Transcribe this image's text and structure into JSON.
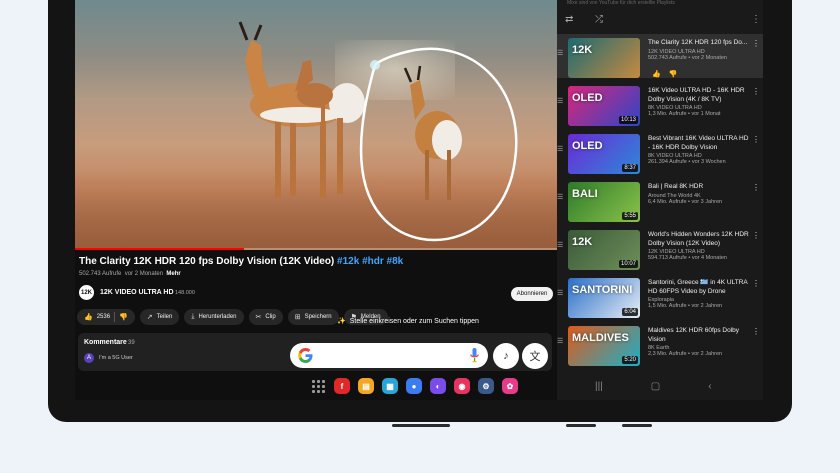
{
  "player": {
    "progress": 0.35
  },
  "video": {
    "title": "The Clarity 12K HDR 120 fps Dolby Vision (12K Video) ",
    "tags": "#12k #hdr #8k",
    "views": "502.743 Aufrufe",
    "age": "vor 2 Monaten",
    "more": "Mehr"
  },
  "channel": {
    "logo_text": "12K",
    "name": "12K VIDEO ULTRA HD",
    "subs": "148.000",
    "subscribe_label": "Abonnieren"
  },
  "actions": {
    "likes": "2536",
    "share": "Teilen",
    "download": "Herunterladen",
    "clip": "Clip",
    "save": "Speichern",
    "report": "Melden"
  },
  "circle_search": {
    "hint": "Stelle einkreisen oder zum Suchen tippen"
  },
  "comments": {
    "label": "Kommentare",
    "count": "39",
    "avatar": "A",
    "preview": "I'm a 5G User"
  },
  "playlist": {
    "hint": "Mixe sind von YouTube für dich erstellte Playlists",
    "items": [
      {
        "title": "The Clarity 12K HDR 120 fps Do...",
        "channel": "12K VIDEO ULTRA HD",
        "meta": "502.743 Aufrufe • vor 2 Monaten",
        "duration": "",
        "label": "12K",
        "c1": "#1d6b73",
        "c2": "#c78a3f"
      },
      {
        "title": "16K Video ULTRA HD - 16K HDR Dolby Vision (4K / 8K TV)",
        "channel": "8K VIDEO ULTRA HD",
        "meta": "1,3 Mio. Aufrufe • vor 1 Monat",
        "duration": "10:13",
        "label": "OLED",
        "c1": "#d9277a",
        "c2": "#2e45c8"
      },
      {
        "title": "Best Vibrant 16K Video ULTRA HD - 16K HDR Dolby Vision",
        "channel": "8K VIDEO ULTRA HD",
        "meta": "261.394 Aufrufe • vor 3 Wochen",
        "duration": "8:37",
        "label": "OLED",
        "c1": "#6a2ad6",
        "c2": "#2e88d8"
      },
      {
        "title": "Bali | Real 8K HDR",
        "channel": "Around The World 4K",
        "meta": "6,4 Mio. Aufrufe • vor 3 Jahren",
        "duration": "5:55",
        "label": "BALI",
        "c1": "#2e7a2a",
        "c2": "#8bc34a"
      },
      {
        "title": "World's Hidden Wonders 12K HDR Dolby Vision (12K Video)",
        "channel": "12K VIDEO ULTRA HD",
        "meta": "594.713 Aufrufe • vor 4 Monaten",
        "duration": "10:07",
        "label": "12K",
        "c1": "#3b5a3a",
        "c2": "#6e8f5a"
      },
      {
        "title": "Santorini, Greece 🇬🇷 in 4K ULTRA HD 60FPS Video by Drone",
        "channel": "Explorapia",
        "meta": "1,5 Mio. Aufrufe • vor 2 Jahren",
        "duration": "6:04",
        "label": "SANTORINI",
        "c1": "#2a6fc9",
        "c2": "#e7eef5"
      },
      {
        "title": "Maldives 12K HDR 60fps Dolby Vision",
        "channel": "8K Earth",
        "meta": "2,3 Mio. Aufrufe • vor 2 Jahren",
        "duration": "5:20",
        "label": "MALDIVES",
        "c1": "#e05a1a",
        "c2": "#1ab0c9"
      }
    ],
    "first_like": "👍",
    "first_dislike": "👎"
  },
  "colors": {
    "accent_link": "#3ea6ff",
    "progress": "#ff0000",
    "bg_dark": "#0f0f0f"
  },
  "taskbar": {
    "apps": [
      {
        "name": "flipboard-icon",
        "color": "#e12828",
        "glyph": "f"
      },
      {
        "name": "files-icon",
        "color": "#f5a623",
        "glyph": "▤"
      },
      {
        "name": "calendar-icon",
        "color": "#2aa3d6",
        "glyph": "▦"
      },
      {
        "name": "messages-icon",
        "color": "#3c7bf0",
        "glyph": "●"
      },
      {
        "name": "internet-icon",
        "color": "#7a4de8",
        "glyph": "◐"
      },
      {
        "name": "camera-icon",
        "color": "#e8335f",
        "glyph": "◉"
      },
      {
        "name": "settings-icon",
        "color": "#3a5a8a",
        "glyph": "⚙"
      },
      {
        "name": "bixby-icon",
        "color": "#e83a8a",
        "glyph": "✿"
      }
    ]
  }
}
